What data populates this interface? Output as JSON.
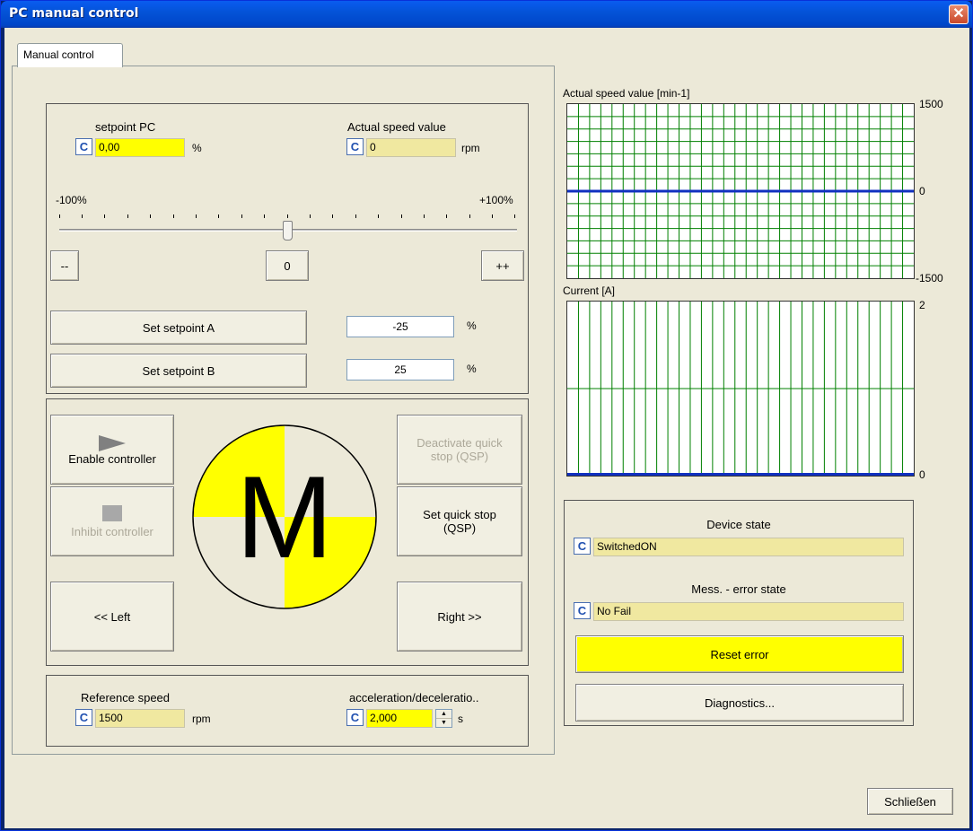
{
  "window": {
    "title": "PC manual control",
    "close_glyph": "✕"
  },
  "tab": {
    "label": "Manual control"
  },
  "setpoint": {
    "setpoint_pc_label": "setpoint PC",
    "setpoint_pc_value": "0,00",
    "setpoint_pc_unit": "%",
    "actual_speed_label": "Actual speed value",
    "actual_speed_value": "0",
    "actual_speed_unit": "rpm",
    "c_label": "C",
    "slider_min_label": "-100%",
    "slider_max_label": "+100%",
    "slider_value_percent": 0,
    "decrease_label": "--",
    "zero_label": "0",
    "increase_label": "++",
    "set_a_label": "Set setpoint A",
    "set_a_value": "-25",
    "set_a_unit": "%",
    "set_b_label": "Set setpoint B",
    "set_b_value": "25",
    "set_b_unit": "%"
  },
  "control": {
    "enable_label": "Enable controller",
    "inhibit_label": "Inhibit controller",
    "deactivate_qsp_label": "Deactivate quick stop (QSP)",
    "set_qsp_label": "Set quick stop (QSP)",
    "left_label": "<< Left",
    "right_label": "Right >>",
    "motor_letter": "M",
    "motor_color": "#ffff00"
  },
  "reference": {
    "reference_speed_label": "Reference speed",
    "reference_speed_value": "1500",
    "reference_speed_unit": "rpm",
    "accel_label": "acceleration/deceleratio..",
    "accel_value": "2,000",
    "accel_unit": "s"
  },
  "charts": {
    "speed_label": "Actual speed value [min-1]",
    "speed_max": "1500",
    "speed_zero": "0",
    "speed_min": "-1500",
    "current_label": "Current [A]",
    "current_max": "2",
    "current_zero": "0"
  },
  "chart_data": [
    {
      "type": "line",
      "title": "Actual speed value [min-1]",
      "ylim": [
        -1500,
        1500
      ],
      "grid": true,
      "series": [
        {
          "values": [
            0,
            0
          ]
        }
      ],
      "line_color": "#1030c0",
      "grid_color": "#008000"
    },
    {
      "type": "line",
      "title": "Current [A]",
      "ylim": [
        0,
        2
      ],
      "grid": true,
      "series": [
        {
          "values": [
            0,
            0
          ]
        }
      ],
      "line_color": "#1030c0",
      "grid_color": "#008000"
    }
  ],
  "status": {
    "device_state_label": "Device state",
    "device_state_value": "SwitchedON",
    "error_state_label": "Mess. - error state",
    "error_state_value": "No Fail",
    "reset_label": "Reset error",
    "diagnostics_label": "Diagnostics..."
  },
  "footer": {
    "close_label": "Schließen"
  }
}
